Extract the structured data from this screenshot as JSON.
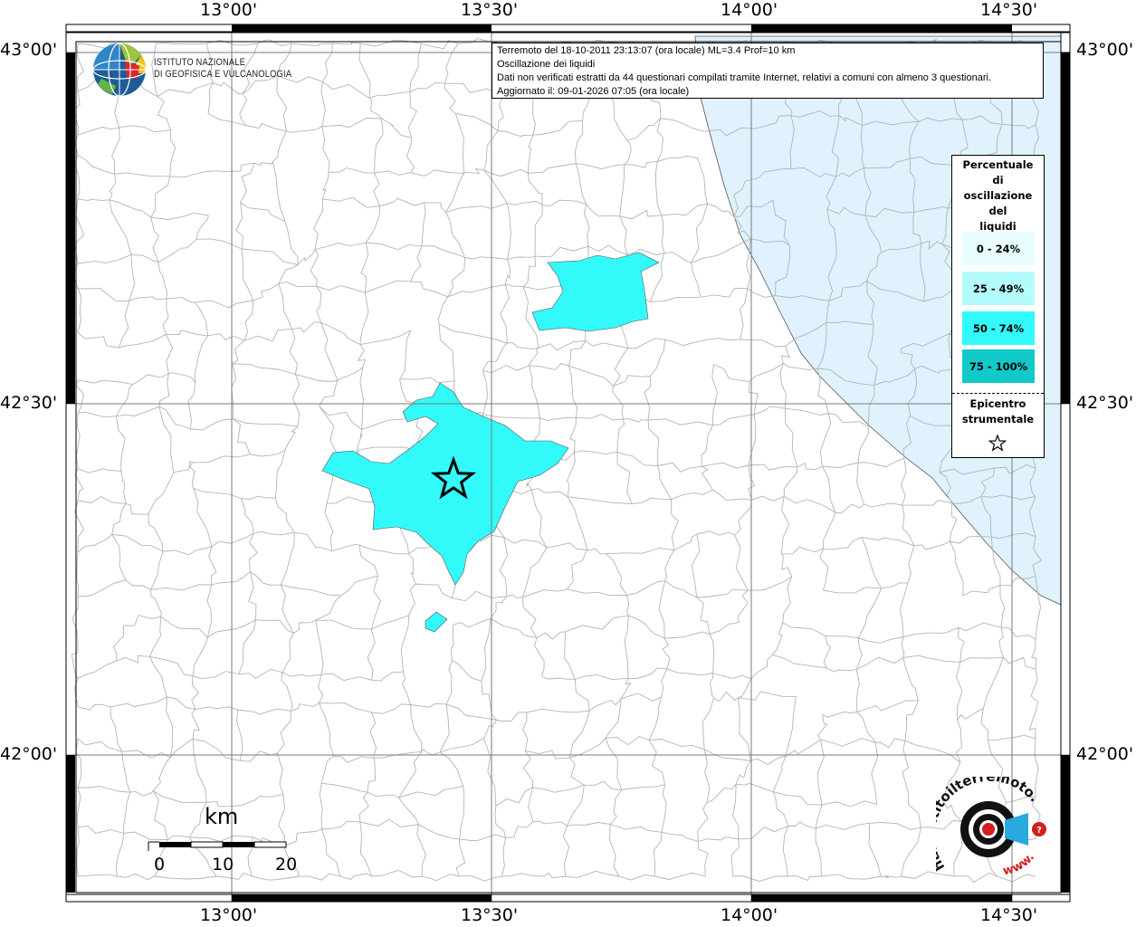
{
  "header": {
    "line1": "Terremoto del 18-10-2011 23:13:07 (ora locale) ML=3.4 Prof=10 km",
    "line2": "Oscillazione dei liquidi",
    "line3": "Dati non verificati estratti da 44 questionari compilati tramite Internet, relativi a comuni con almeno 3 questionari.",
    "line4": "Aggiornato il: 09-01-2026 07:05 (ora locale)"
  },
  "institute": {
    "line1": "ISTITUTO NAZIONALE",
    "line2": "DI GEOFISICA E VULCANOLOGIA"
  },
  "legend": {
    "title": [
      "Percentuale",
      "di",
      "oscillazione",
      "del",
      "liquidi"
    ],
    "classes": [
      {
        "label": "0 - 24%",
        "color": "#e8fefe"
      },
      {
        "label": "25 - 49%",
        "color": "#b4fcfc"
      },
      {
        "label": "50 - 74%",
        "color": "#33fafa"
      },
      {
        "label": "75 - 100%",
        "color": "#12c9c9"
      }
    ],
    "epicenter_label": [
      "Epicentro",
      "strumentale"
    ]
  },
  "axes": {
    "lon_ticks": [
      "13°00'",
      "13°30'",
      "14°00'",
      "14°30'"
    ],
    "lat_ticks": [
      "43°00'",
      "42°30'",
      "42°00'"
    ]
  },
  "scalebar": {
    "unit": "km",
    "labels": [
      "0",
      "10",
      "20"
    ]
  },
  "logo": {
    "text_arc": "haisentitoilterremoto.it",
    "text_www": "www."
  },
  "colors": {
    "sea": "#dff2fd",
    "municipal_border": "#b4b4b4",
    "grid": "#888888"
  }
}
